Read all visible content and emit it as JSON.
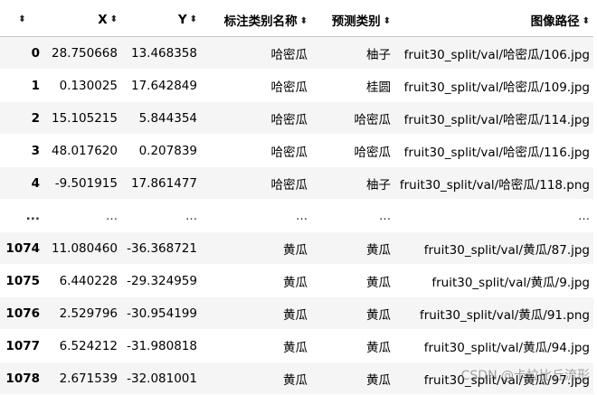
{
  "table": {
    "columns": [
      {
        "key": "index",
        "label": ""
      },
      {
        "key": "x",
        "label": "X"
      },
      {
        "key": "y",
        "label": "Y"
      },
      {
        "key": "label_name",
        "label": "标注类别名称"
      },
      {
        "key": "pred_name",
        "label": "预测类别"
      },
      {
        "key": "path",
        "label": "图像路径"
      }
    ],
    "sort_glyph": "⬍",
    "rows": [
      {
        "index": "0",
        "x": "28.750668",
        "y": "13.468358",
        "label_name": "哈密瓜",
        "pred_name": "柚子",
        "path": "fruit30_split/val/哈密瓜/106.jpg"
      },
      {
        "index": "1",
        "x": "0.130025",
        "y": "17.642849",
        "label_name": "哈密瓜",
        "pred_name": "桂圆",
        "path": "fruit30_split/val/哈密瓜/109.jpg"
      },
      {
        "index": "2",
        "x": "15.105215",
        "y": "5.844354",
        "label_name": "哈密瓜",
        "pred_name": "哈密瓜",
        "path": "fruit30_split/val/哈密瓜/114.jpg"
      },
      {
        "index": "3",
        "x": "48.017620",
        "y": "0.207839",
        "label_name": "哈密瓜",
        "pred_name": "哈密瓜",
        "path": "fruit30_split/val/哈密瓜/116.jpg"
      },
      {
        "index": "4",
        "x": "-9.501915",
        "y": "17.861477",
        "label_name": "哈密瓜",
        "pred_name": "柚子",
        "path": "fruit30_split/val/哈密瓜/118.png"
      },
      {
        "index": "...",
        "x": "...",
        "y": "...",
        "label_name": "...",
        "pred_name": "...",
        "path": "...",
        "ellipsis": true
      },
      {
        "index": "1074",
        "x": "11.080460",
        "y": "-36.368721",
        "label_name": "黄瓜",
        "pred_name": "黄瓜",
        "path": "fruit30_split/val/黄瓜/87.jpg"
      },
      {
        "index": "1075",
        "x": "6.440228",
        "y": "-29.324959",
        "label_name": "黄瓜",
        "pred_name": "黄瓜",
        "path": "fruit30_split/val/黄瓜/9.jpg"
      },
      {
        "index": "1076",
        "x": "2.529796",
        "y": "-30.954199",
        "label_name": "黄瓜",
        "pred_name": "黄瓜",
        "path": "fruit30_split/val/黄瓜/91.png"
      },
      {
        "index": "1077",
        "x": "6.524212",
        "y": "-31.980818",
        "label_name": "黄瓜",
        "pred_name": "黄瓜",
        "path": "fruit30_split/val/黄瓜/94.jpg"
      },
      {
        "index": "1078",
        "x": "2.671539",
        "y": "-32.081001",
        "label_name": "黄瓜",
        "pred_name": "黄瓜",
        "path": "fruit30_split/val/黄瓜/97.jpg"
      }
    ]
  },
  "watermark": {
    "text": "CSDN @卡拉比丘流形"
  }
}
